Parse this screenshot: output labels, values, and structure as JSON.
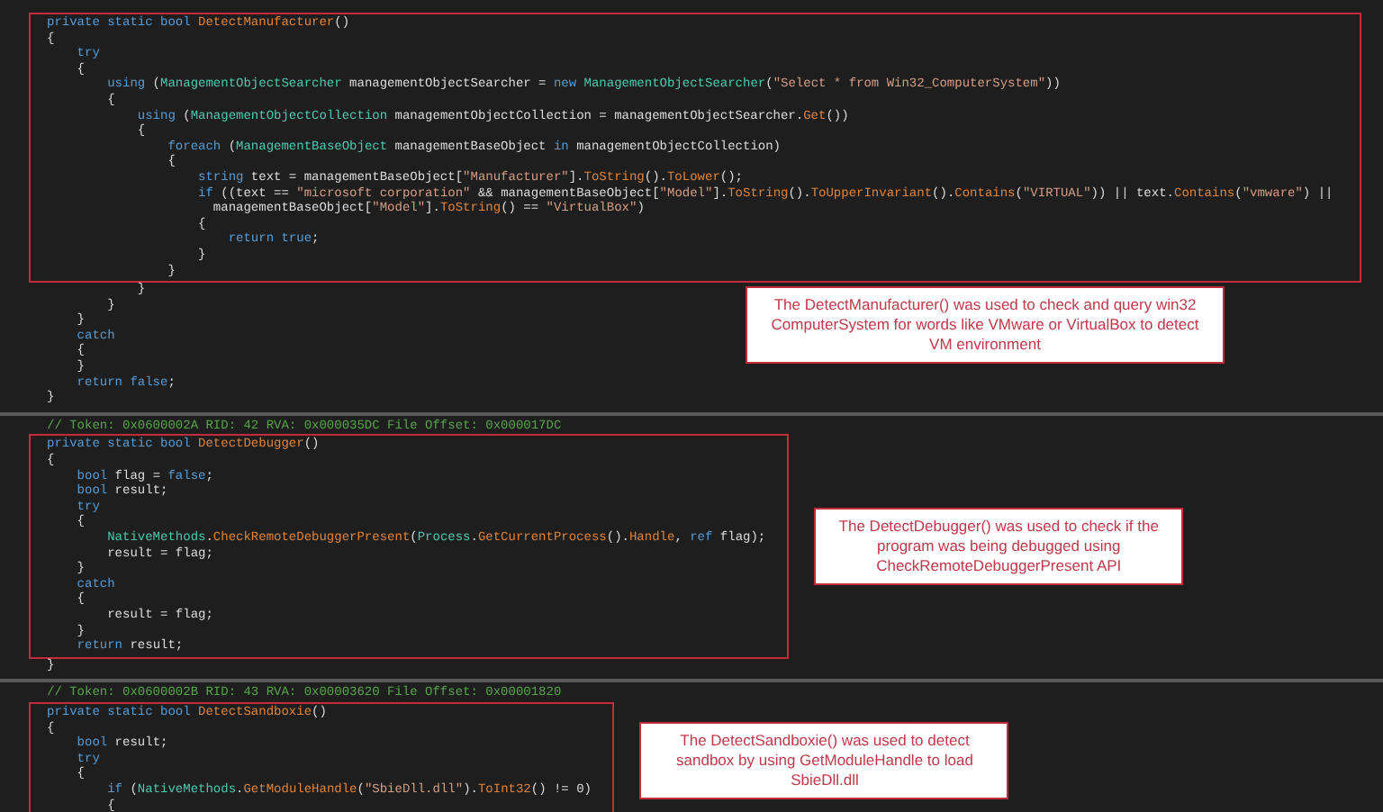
{
  "sections": [
    {
      "kind": "below",
      "box_lines": [
        [
          {
            "kind": "kw",
            "text": "private static bool "
          },
          {
            "kind": "fn",
            "text": "DetectManufacturer"
          },
          {
            "kind": "txt",
            "text": "()"
          }
        ],
        [
          {
            "kind": "txt",
            "text": "{"
          }
        ],
        [
          {
            "kind": "kw",
            "text": "    try"
          }
        ],
        [
          {
            "kind": "txt",
            "text": "    {"
          }
        ],
        [
          {
            "kind": "kw",
            "text": "        using"
          },
          {
            "kind": "txt",
            "text": " ("
          },
          {
            "kind": "type",
            "text": "ManagementObjectSearcher"
          },
          {
            "kind": "txt",
            "text": " managementObjectSearcher = "
          },
          {
            "kind": "kw",
            "text": "new"
          },
          {
            "kind": "type",
            "text": " ManagementObjectSearcher"
          },
          {
            "kind": "txt",
            "text": "("
          },
          {
            "kind": "str",
            "text": "\"Select * from Win32_ComputerSystem\""
          },
          {
            "kind": "txt",
            "text": "))"
          }
        ],
        [
          {
            "kind": "txt",
            "text": "        {"
          }
        ],
        [
          {
            "kind": "kw",
            "text": "            using"
          },
          {
            "kind": "txt",
            "text": " ("
          },
          {
            "kind": "type",
            "text": "ManagementObjectCollection"
          },
          {
            "kind": "txt",
            "text": " managementObjectCollection = managementObjectSearcher."
          },
          {
            "kind": "fn",
            "text": "Get"
          },
          {
            "kind": "txt",
            "text": "())"
          }
        ],
        [
          {
            "kind": "txt",
            "text": "            {"
          }
        ],
        [
          {
            "kind": "kw",
            "text": "                foreach"
          },
          {
            "kind": "txt",
            "text": " ("
          },
          {
            "kind": "type",
            "text": "ManagementBaseObject"
          },
          {
            "kind": "txt",
            "text": " managementBaseObject "
          },
          {
            "kind": "kw",
            "text": "in"
          },
          {
            "kind": "txt",
            "text": " managementObjectCollection)"
          }
        ],
        [
          {
            "kind": "txt",
            "text": "                {"
          }
        ],
        [
          {
            "kind": "kw",
            "text": "                    string"
          },
          {
            "kind": "txt",
            "text": " text = managementBaseObject["
          },
          {
            "kind": "str",
            "text": "\"Manufacturer\""
          },
          {
            "kind": "txt",
            "text": "]."
          },
          {
            "kind": "fn",
            "text": "ToString"
          },
          {
            "kind": "txt",
            "text": "()."
          },
          {
            "kind": "fn",
            "text": "ToLower"
          },
          {
            "kind": "txt",
            "text": "();"
          }
        ],
        [
          {
            "kind": "kw",
            "text": "                    if"
          },
          {
            "kind": "txt",
            "text": " ((text == "
          },
          {
            "kind": "str",
            "text": "\"microsoft corporation\""
          },
          {
            "kind": "txt",
            "text": " && managementBaseObject["
          },
          {
            "kind": "str",
            "text": "\"Model\""
          },
          {
            "kind": "txt",
            "text": "]."
          },
          {
            "kind": "fn",
            "text": "ToString"
          },
          {
            "kind": "txt",
            "text": "()."
          },
          {
            "kind": "fn",
            "text": "ToUpperInvariant"
          },
          {
            "kind": "txt",
            "text": "()."
          },
          {
            "kind": "fn",
            "text": "Contains"
          },
          {
            "kind": "txt",
            "text": "("
          },
          {
            "kind": "str",
            "text": "\"VIRTUAL\""
          },
          {
            "kind": "txt",
            "text": ")) || text."
          },
          {
            "kind": "fn",
            "text": "Contains"
          },
          {
            "kind": "txt",
            "text": "("
          },
          {
            "kind": "str",
            "text": "\"vmware\""
          },
          {
            "kind": "txt",
            "text": ") ||"
          }
        ],
        [
          {
            "kind": "txt",
            "text": "                      managementBaseObject["
          },
          {
            "kind": "str",
            "text": "\"Model\""
          },
          {
            "kind": "txt",
            "text": "]."
          },
          {
            "kind": "fn",
            "text": "ToString"
          },
          {
            "kind": "txt",
            "text": "() == "
          },
          {
            "kind": "str",
            "text": "\"VirtualBox\""
          },
          {
            "kind": "txt",
            "text": ")"
          }
        ],
        [
          {
            "kind": "txt",
            "text": "                    {"
          }
        ],
        [
          {
            "kind": "kw",
            "text": "                        return true"
          },
          {
            "kind": "txt",
            "text": ";"
          }
        ],
        [
          {
            "kind": "txt",
            "text": "                    }"
          }
        ],
        [
          {
            "kind": "txt",
            "text": "                }"
          }
        ]
      ],
      "trailing_lines": [
        [
          {
            "kind": "txt",
            "text": "            }"
          }
        ],
        [
          {
            "kind": "txt",
            "text": "        }"
          }
        ],
        [
          {
            "kind": "txt",
            "text": "    }"
          }
        ],
        [
          {
            "kind": "kw",
            "text": "    catch"
          }
        ],
        [
          {
            "kind": "txt",
            "text": "    {"
          }
        ],
        [
          {
            "kind": "txt",
            "text": "    }"
          }
        ],
        [
          {
            "kind": "kw",
            "text": "    return false"
          },
          {
            "kind": "txt",
            "text": ";"
          }
        ],
        [
          {
            "kind": "txt",
            "text": "}"
          }
        ]
      ],
      "note": "The DetectManufacturer() was used to check and query win32 ComputerSystem for words like VMware or VirtualBox to detect VM environment"
    },
    {
      "kind": "beside",
      "comment": "// Token: 0x0600002A RID: 42 RVA: 0x000035DC File Offset: 0x000017DC",
      "box_lines": [
        [
          {
            "kind": "kw",
            "text": "private static bool "
          },
          {
            "kind": "fn",
            "text": "DetectDebugger"
          },
          {
            "kind": "txt",
            "text": "()"
          }
        ],
        [
          {
            "kind": "txt",
            "text": "{"
          }
        ],
        [
          {
            "kind": "kw",
            "text": "    bool"
          },
          {
            "kind": "txt",
            "text": " flag = "
          },
          {
            "kind": "kw",
            "text": "false"
          },
          {
            "kind": "txt",
            "text": ";"
          }
        ],
        [
          {
            "kind": "kw",
            "text": "    bool"
          },
          {
            "kind": "txt",
            "text": " result;"
          }
        ],
        [
          {
            "kind": "kw",
            "text": "    try"
          }
        ],
        [
          {
            "kind": "txt",
            "text": "    {"
          }
        ],
        [
          {
            "kind": "type",
            "text": "        NativeMethods"
          },
          {
            "kind": "txt",
            "text": "."
          },
          {
            "kind": "fn",
            "text": "CheckRemoteDebuggerPresent"
          },
          {
            "kind": "txt",
            "text": "("
          },
          {
            "kind": "type",
            "text": "Process"
          },
          {
            "kind": "txt",
            "text": "."
          },
          {
            "kind": "fn",
            "text": "GetCurrentProcess"
          },
          {
            "kind": "txt",
            "text": "()."
          },
          {
            "kind": "fn",
            "text": "Handle"
          },
          {
            "kind": "txt",
            "text": ", "
          },
          {
            "kind": "kw",
            "text": "ref"
          },
          {
            "kind": "txt",
            "text": " flag);"
          }
        ],
        [
          {
            "kind": "txt",
            "text": "        result = flag;"
          }
        ],
        [
          {
            "kind": "txt",
            "text": "    }"
          }
        ],
        [
          {
            "kind": "kw",
            "text": "    catch"
          }
        ],
        [
          {
            "kind": "txt",
            "text": "    {"
          }
        ],
        [
          {
            "kind": "txt",
            "text": "        result = flag;"
          }
        ],
        [
          {
            "kind": "txt",
            "text": "    }"
          }
        ],
        [
          {
            "kind": "kw",
            "text": "    return"
          },
          {
            "kind": "txt",
            "text": " result;"
          }
        ]
      ],
      "trailing_lines": [
        [
          {
            "kind": "txt",
            "text": "}"
          }
        ]
      ],
      "note": "The DetectDebugger() was used to check if the program was being debugged using CheckRemoteDebuggerPresent API"
    },
    {
      "kind": "beside",
      "comment": "// Token: 0x0600002B RID: 43 RVA: 0x00003620 File Offset: 0x00001820",
      "box_lines": [
        [
          {
            "kind": "kw",
            "text": "private static bool "
          },
          {
            "kind": "fn",
            "text": "DetectSandboxie"
          },
          {
            "kind": "txt",
            "text": "()"
          }
        ],
        [
          {
            "kind": "txt",
            "text": "{"
          }
        ],
        [
          {
            "kind": "kw",
            "text": "    bool"
          },
          {
            "kind": "txt",
            "text": " result;"
          }
        ],
        [
          {
            "kind": "kw",
            "text": "    try"
          }
        ],
        [
          {
            "kind": "txt",
            "text": "    {"
          }
        ],
        [
          {
            "kind": "kw",
            "text": "        if"
          },
          {
            "kind": "txt",
            "text": " ("
          },
          {
            "kind": "type",
            "text": "NativeMethods"
          },
          {
            "kind": "txt",
            "text": "."
          },
          {
            "kind": "fn",
            "text": "GetModuleHandle"
          },
          {
            "kind": "txt",
            "text": "("
          },
          {
            "kind": "str",
            "text": "\"SbieDll.dll\""
          },
          {
            "kind": "txt",
            "text": ")."
          },
          {
            "kind": "fn",
            "text": "ToInt32"
          },
          {
            "kind": "txt",
            "text": "() != 0)"
          }
        ],
        [
          {
            "kind": "txt",
            "text": "        {"
          }
        ]
      ],
      "note": "The DetectSandboxie() was used to detect sandbox by using GetModuleHandle to load SbieDll.dll"
    }
  ]
}
